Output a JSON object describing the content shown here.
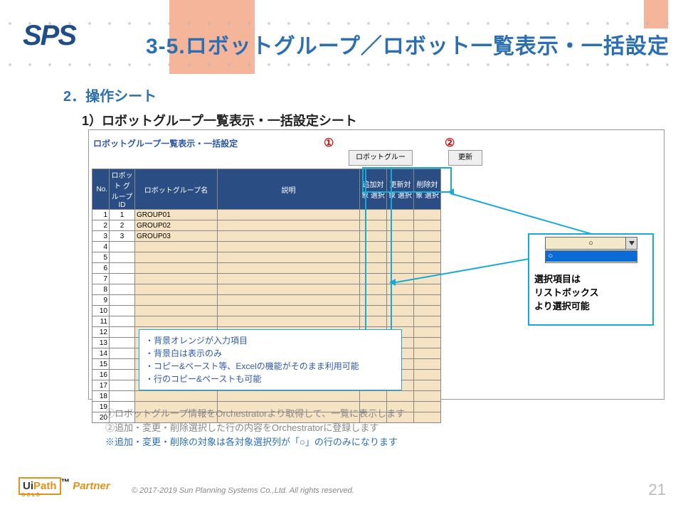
{
  "logo": "SPS",
  "title": "3-5.ロボットグループ／ロボット一覧表示・一括設定",
  "section": "2．操作シート",
  "subsection": "1）ロボットグループ一覧表示・一括設定シート",
  "panel": {
    "heading": "ロボットグループ一覧表示・一括設定",
    "marker1": "①",
    "marker2": "②",
    "btn_fetch": "ロボットグループ取得",
    "btn_update": "更新",
    "headers": {
      "no": "No.",
      "gid": "ロボット\nグループID",
      "gnm": "ロボットグループ名",
      "desc": "説明",
      "add": "追加対象\n選択",
      "upd": "更新対象\n選択",
      "del": "削除対象\n選択"
    },
    "rows": [
      {
        "no": 1,
        "gid": "1",
        "gnm": "GROUP01"
      },
      {
        "no": 2,
        "gid": "2",
        "gnm": "GROUP02"
      },
      {
        "no": 3,
        "gid": "3",
        "gnm": "GROUP03"
      },
      {
        "no": 4
      },
      {
        "no": 5
      },
      {
        "no": 6
      },
      {
        "no": 7
      },
      {
        "no": 8
      },
      {
        "no": 9
      },
      {
        "no": 10
      },
      {
        "no": 11
      },
      {
        "no": 12
      },
      {
        "no": 13
      },
      {
        "no": 14
      },
      {
        "no": 15
      },
      {
        "no": 16
      },
      {
        "no": 17
      },
      {
        "no": 18
      },
      {
        "no": 19
      },
      {
        "no": 20
      }
    ]
  },
  "popup": {
    "value": "○",
    "option": "○",
    "text1": "選択項目は",
    "text2": "リストボックス",
    "text3": "より選択可能"
  },
  "notes": {
    "l1": "・背景オレンジが入力項目",
    "l2": "・背景白は表示のみ",
    "l3": "・コピー&ペースト等、Excelの機能がそのまま利用可能",
    "l4": "・行のコピー&ペーストも可能"
  },
  "bottom": {
    "d1": "①ロボットグループ情報をOrchestratorより取得して、一覧に表示します",
    "d2": "②追加・変更・削除選択した行の内容をOrchestratorに登録します",
    "d3": "※追加・変更・削除の対象は各対象選択列が「○」の行のみになります"
  },
  "footer": {
    "ui": "Ui",
    "path": "Path",
    "tm": "™",
    "partner": "Partner",
    "gold": "GOLD",
    "copyright": "© 2017-2019 Sun Planning Systems Co.,Ltd. All rights reserved.",
    "page": "21"
  }
}
